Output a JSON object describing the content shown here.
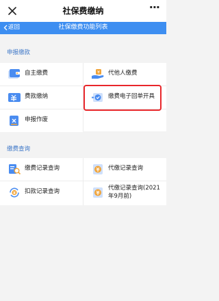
{
  "window": {
    "title": "社保费缴纳",
    "close_icon": "close-icon",
    "more_icon": "more-icon",
    "more_glyph": "···"
  },
  "nav": {
    "back_label": "返回",
    "title": "社保缴费功能列表"
  },
  "sections": [
    {
      "title": "申报缴款",
      "items": [
        {
          "label": "自主缴费",
          "icon": "wallet-icon"
        },
        {
          "label": "代他人缴费",
          "icon": "hand-money-icon"
        },
        {
          "label": "费款缴纳",
          "icon": "yuan-card-icon"
        },
        {
          "label": "缴费电子回单开具",
          "icon": "e-receipt-icon"
        },
        {
          "label": "申报作废",
          "icon": "void-doc-icon"
        }
      ]
    },
    {
      "title": "缴费查询",
      "items": [
        {
          "label": "缴费记录查询",
          "icon": "search-doc-icon"
        },
        {
          "label": "代缴记录查询",
          "icon": "yuan-doc-icon"
        },
        {
          "label": "扣款记录查询",
          "icon": "yuan-refresh-icon"
        },
        {
          "label": "代缴记录查询(2021年9月前)",
          "icon": "yuan-doc-old-icon"
        }
      ]
    }
  ],
  "colors": {
    "nav_blue": "#3d8ef1",
    "section_title": "#3f78c8",
    "highlight_red": "#e8262a",
    "icon_blue": "#4a8cf0",
    "icon_orange": "#f0a43a"
  }
}
